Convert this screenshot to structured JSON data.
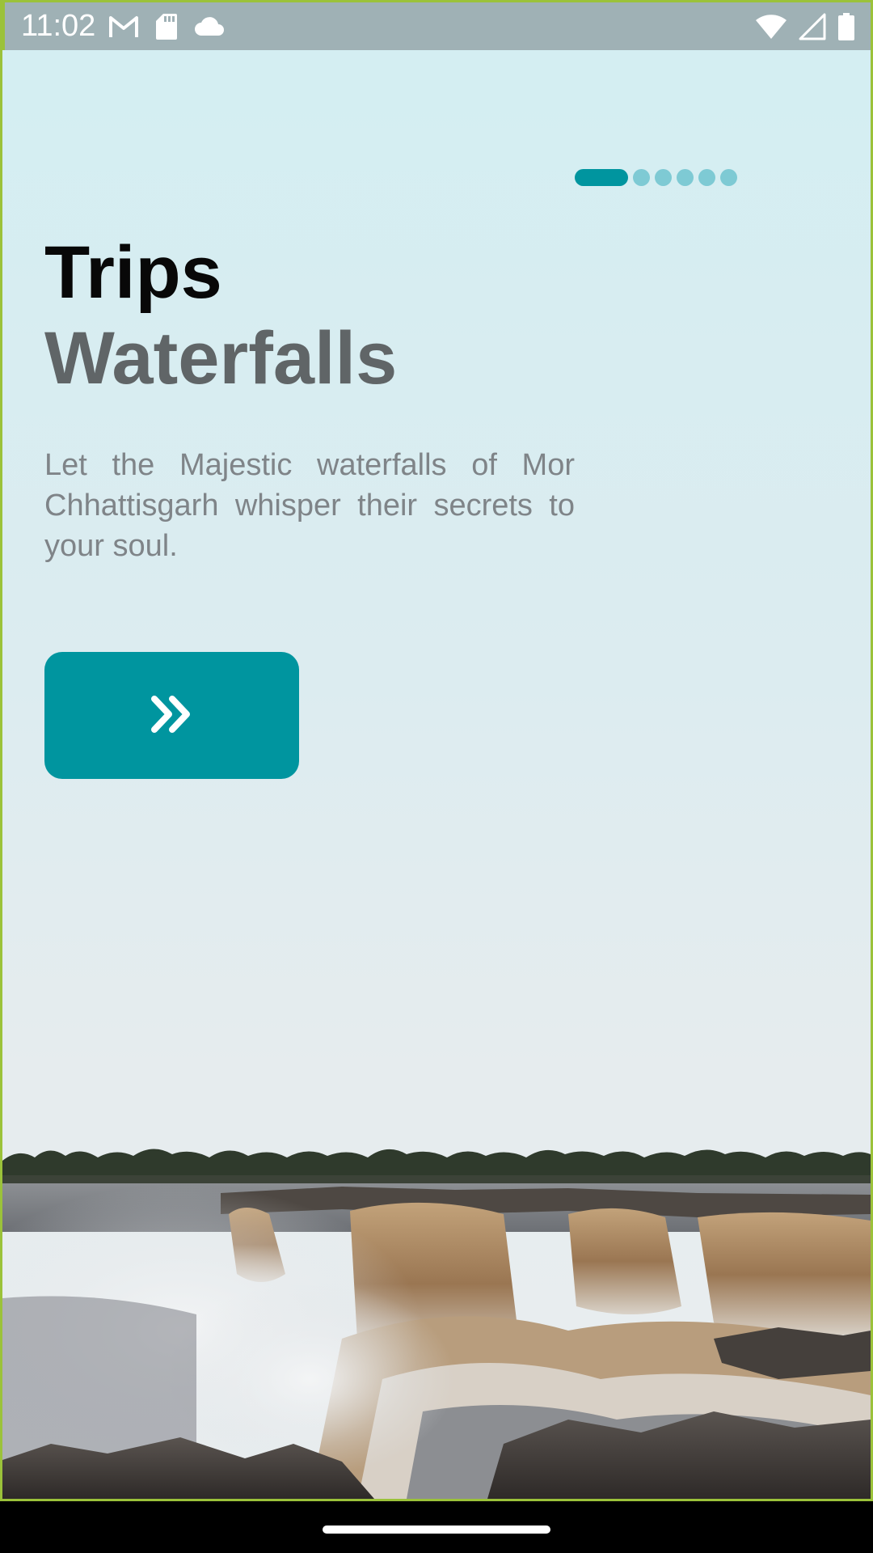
{
  "status_bar": {
    "time": "11:02",
    "left_icons": [
      "gmail-icon",
      "sd-card-icon",
      "cloud-icon"
    ],
    "right_icons": [
      "wifi-icon",
      "cellular-signal-icon",
      "battery-icon"
    ]
  },
  "onboarding": {
    "page_count": 6,
    "current_page": 1,
    "title": "Trips",
    "subtitle": "Waterfalls",
    "description": "Let the Majestic waterfalls of Mor Chhattisgarh whisper their secrets to your soul.",
    "next_button_icon": "double-chevron-right-icon"
  },
  "colors": {
    "accent": "#00959f",
    "dot_inactive": "#7ecad4",
    "title": "#080808",
    "subtitle": "#606567",
    "description": "#7f8488",
    "background_top": "#d3eef2"
  }
}
